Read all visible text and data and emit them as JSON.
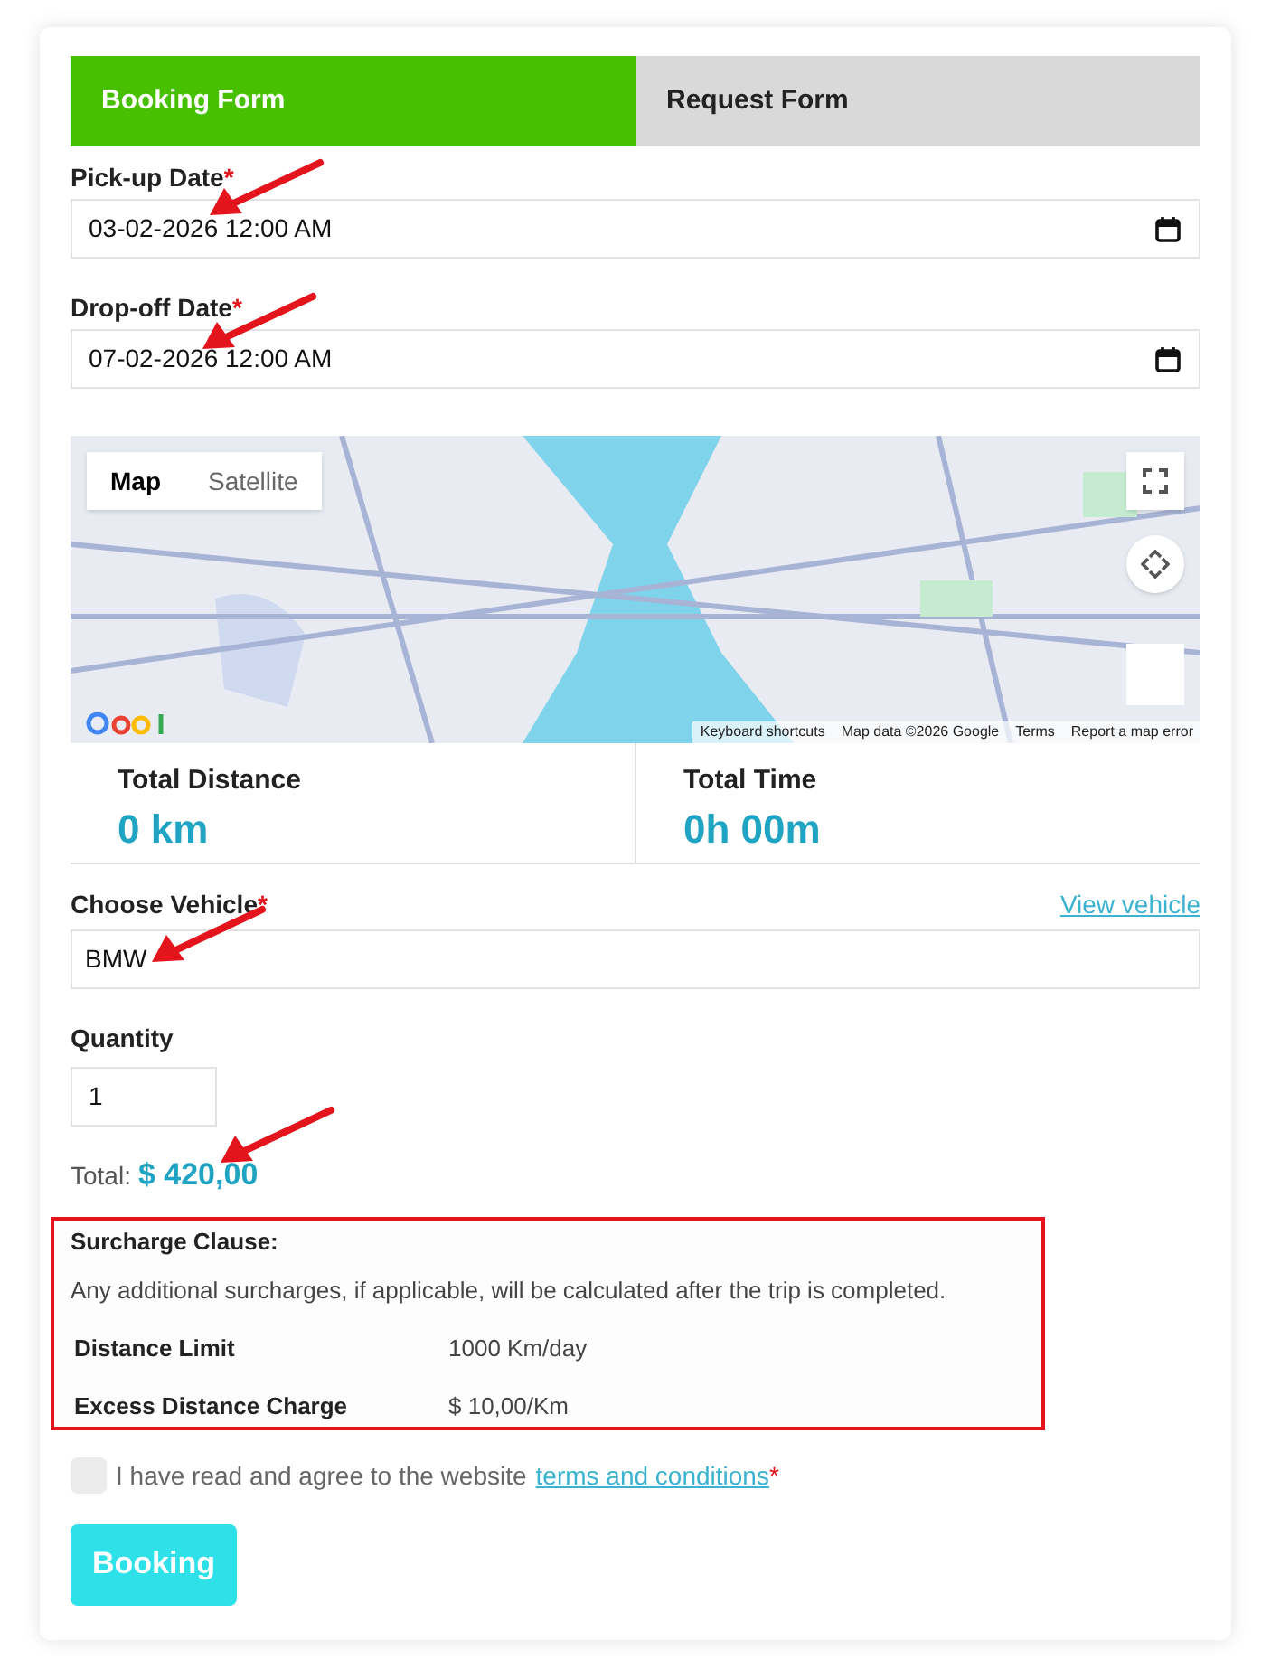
{
  "tabs": [
    {
      "label": "Booking Form",
      "selected": true
    },
    {
      "label": "Request Form",
      "selected": false
    }
  ],
  "pickup": {
    "label": "Pick-up Date",
    "required_mark": "*",
    "value": "03-02-2026 12:00 AM"
  },
  "dropoff": {
    "label": "Drop-off Date",
    "required_mark": "*",
    "value": "07-02-2026 12:00 AM"
  },
  "map": {
    "types": [
      {
        "label": "Map",
        "selected": true
      },
      {
        "label": "Satellite",
        "selected": false
      }
    ],
    "attribution": [
      "Keyboard shortcuts",
      "Map data ©2026 Google",
      "Terms",
      "Report a map error"
    ]
  },
  "stats": [
    {
      "label": "Total Distance",
      "value": "0 km"
    },
    {
      "label": "Total Time",
      "value": "0h 00m"
    }
  ],
  "vehicle": {
    "label": "Choose Vehicle",
    "required_mark": "*",
    "link": "View vehicle",
    "value": "BMW"
  },
  "quantity": {
    "label": "Quantity",
    "value": "1"
  },
  "total": {
    "label": "Total:",
    "value": "$ 420,00"
  },
  "surcharge": {
    "title": "Surcharge Clause:",
    "text": "Any additional surcharges, if applicable, will be calculated after the trip is completed.",
    "rows": [
      {
        "name": "Distance Limit",
        "value": "1000 Km/day"
      },
      {
        "name": "Excess Distance Charge",
        "value": "$ 10,00/Km"
      }
    ]
  },
  "agreement": {
    "checked": false,
    "text": "I have read and agree to the website",
    "link": "terms and conditions",
    "required_mark": "*"
  },
  "submit": "Booking"
}
